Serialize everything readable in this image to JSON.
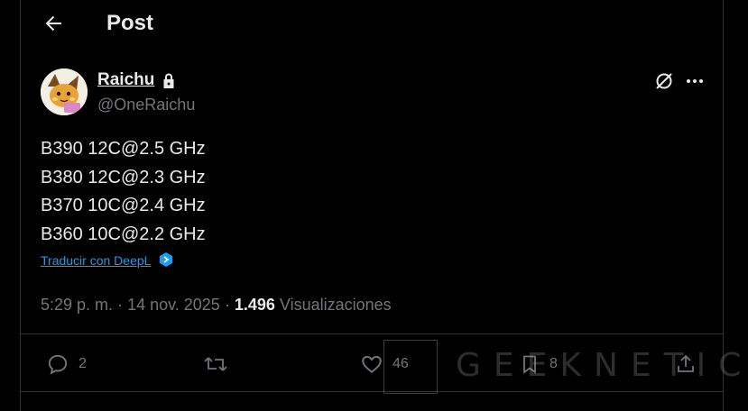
{
  "header": {
    "title": "Post"
  },
  "author": {
    "name": "Raichu",
    "handle": "@OneRaichu",
    "protected": true
  },
  "post": {
    "lines": [
      "B390 12C@2.5 GHz",
      "B380 12C@2.3 GHz",
      "B370 10C@2.4 GHz",
      "B360 10C@2.2 GHz"
    ],
    "translate_label": "Traducir con DeepL",
    "time": "5:29 p. m.",
    "date": "14 nov. 2025",
    "views_count": "1.496",
    "views_label": "Visualizaciones"
  },
  "actions": {
    "replies": "2",
    "reposts": "",
    "likes": "46",
    "bookmarks": "8"
  },
  "watermark": {
    "text": "GEEKNETIC"
  },
  "colors": {
    "background": "#000000",
    "text": "#e7e9ea",
    "muted": "#71767b",
    "link": "#1d9bf0",
    "border": "#2f3336"
  }
}
